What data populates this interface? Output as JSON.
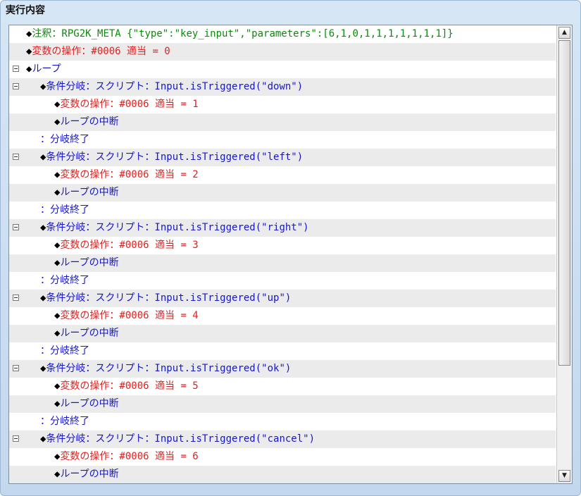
{
  "panel": {
    "title": "実行内容"
  },
  "rows": [
    {
      "indent": 0,
      "collapse": false,
      "diamond": true,
      "text": "注釈：RPG2K_META {\"type\":\"key_input\",\"parameters\":[6,1,0,1,1,1,1,1,1,1]}",
      "color": "#0a8a0a"
    },
    {
      "indent": 0,
      "collapse": false,
      "diamond": true,
      "text": "変数の操作：#0006 適当 = 0",
      "color": "#e02020"
    },
    {
      "indent": 0,
      "collapse": true,
      "diamond": true,
      "text": "ループ",
      "color": "#1717c8"
    },
    {
      "indent": 1,
      "collapse": true,
      "diamond": true,
      "text": "条件分岐：スクリプト：Input.isTriggered(\"down\")",
      "color": "#1717c8"
    },
    {
      "indent": 2,
      "collapse": false,
      "diamond": true,
      "text": "変数の操作：#0006 適当 = 1",
      "color": "#e02020"
    },
    {
      "indent": 2,
      "collapse": false,
      "diamond": true,
      "text": "ループの中断",
      "color": "#1717c8"
    },
    {
      "indent": 1,
      "collapse": false,
      "diamond": false,
      "text": "：分岐終了",
      "color": "#1717c8"
    },
    {
      "indent": 1,
      "collapse": true,
      "diamond": true,
      "text": "条件分岐：スクリプト：Input.isTriggered(\"left\")",
      "color": "#1717c8"
    },
    {
      "indent": 2,
      "collapse": false,
      "diamond": true,
      "text": "変数の操作：#0006 適当 = 2",
      "color": "#e02020"
    },
    {
      "indent": 2,
      "collapse": false,
      "diamond": true,
      "text": "ループの中断",
      "color": "#1717c8"
    },
    {
      "indent": 1,
      "collapse": false,
      "diamond": false,
      "text": "：分岐終了",
      "color": "#1717c8"
    },
    {
      "indent": 1,
      "collapse": true,
      "diamond": true,
      "text": "条件分岐：スクリプト：Input.isTriggered(\"right\")",
      "color": "#1717c8"
    },
    {
      "indent": 2,
      "collapse": false,
      "diamond": true,
      "text": "変数の操作：#0006 適当 = 3",
      "color": "#e02020"
    },
    {
      "indent": 2,
      "collapse": false,
      "diamond": true,
      "text": "ループの中断",
      "color": "#1717c8"
    },
    {
      "indent": 1,
      "collapse": false,
      "diamond": false,
      "text": "：分岐終了",
      "color": "#1717c8"
    },
    {
      "indent": 1,
      "collapse": true,
      "diamond": true,
      "text": "条件分岐：スクリプト：Input.isTriggered(\"up\")",
      "color": "#1717c8"
    },
    {
      "indent": 2,
      "collapse": false,
      "diamond": true,
      "text": "変数の操作：#0006 適当 = 4",
      "color": "#e02020"
    },
    {
      "indent": 2,
      "collapse": false,
      "diamond": true,
      "text": "ループの中断",
      "color": "#1717c8"
    },
    {
      "indent": 1,
      "collapse": false,
      "diamond": false,
      "text": "：分岐終了",
      "color": "#1717c8"
    },
    {
      "indent": 1,
      "collapse": true,
      "diamond": true,
      "text": "条件分岐：スクリプト：Input.isTriggered(\"ok\")",
      "color": "#1717c8"
    },
    {
      "indent": 2,
      "collapse": false,
      "diamond": true,
      "text": "変数の操作：#0006 適当 = 5",
      "color": "#e02020"
    },
    {
      "indent": 2,
      "collapse": false,
      "diamond": true,
      "text": "ループの中断",
      "color": "#1717c8"
    },
    {
      "indent": 1,
      "collapse": false,
      "diamond": false,
      "text": "：分岐終了",
      "color": "#1717c8"
    },
    {
      "indent": 1,
      "collapse": true,
      "diamond": true,
      "text": "条件分岐：スクリプト：Input.isTriggered(\"cancel\")",
      "color": "#1717c8"
    },
    {
      "indent": 2,
      "collapse": false,
      "diamond": true,
      "text": "変数の操作：#0006 適当 = 6",
      "color": "#e02020"
    },
    {
      "indent": 2,
      "collapse": false,
      "diamond": true,
      "text": "ループの中断",
      "color": "#1717c8"
    }
  ],
  "scrollbar": {
    "up_icon": "▲",
    "down_icon": "▼",
    "thumb_start_fraction": 0.0,
    "thumb_visible_fraction": 0.76
  },
  "glyphs": {
    "diamond": "◆"
  }
}
